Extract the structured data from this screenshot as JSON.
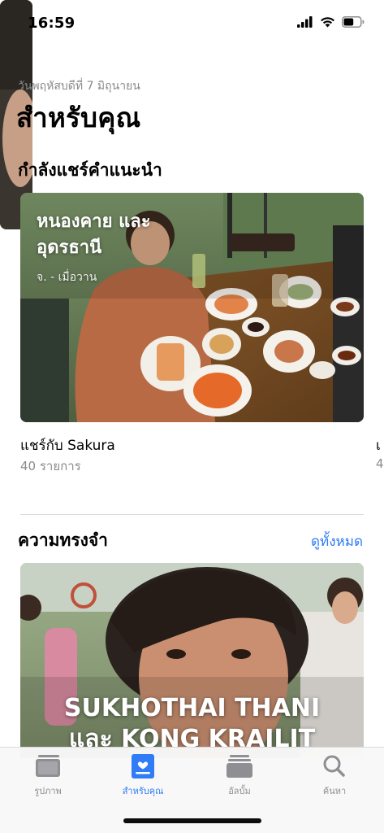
{
  "status_bar": {
    "time": "16:59",
    "battery_level": 0.6
  },
  "header": {
    "date": "วันพฤหัสบดีที่ 7 มิถุนายน",
    "title": "สำหรับคุณ"
  },
  "shared_section": {
    "title": "กำลังแชร์คำแนะนำ",
    "cards": [
      {
        "overlay_title_line1": "หนองคาย และ",
        "overlay_title_line2": "อุดรธานี",
        "overlay_subtitle": "จ. - เมื่อวาน",
        "caption": "แชร์กับ Sakura",
        "count": "40 รายการ"
      },
      {
        "caption": "เ",
        "count": "4"
      }
    ]
  },
  "memories_section": {
    "title": "ความทรงจำ",
    "see_all_label": "ดูทั้งหมด",
    "card": {
      "title_line1": "SUKHOTHAI THANI",
      "title_line2": "และ KONG KRAILIT"
    }
  },
  "tab_bar": {
    "tabs": [
      {
        "label": "รูปภาพ",
        "icon": "photos-icon",
        "active": false
      },
      {
        "label": "สำหรับคุณ",
        "icon": "for-you-icon",
        "active": true
      },
      {
        "label": "อัลบั้ม",
        "icon": "albums-icon",
        "active": false
      },
      {
        "label": "ค้นหา",
        "icon": "search-icon",
        "active": false
      }
    ]
  },
  "colors": {
    "accent": "#2f7cf6",
    "secondary_text": "#8a8a8e",
    "tab_inactive": "#8e8e93"
  }
}
